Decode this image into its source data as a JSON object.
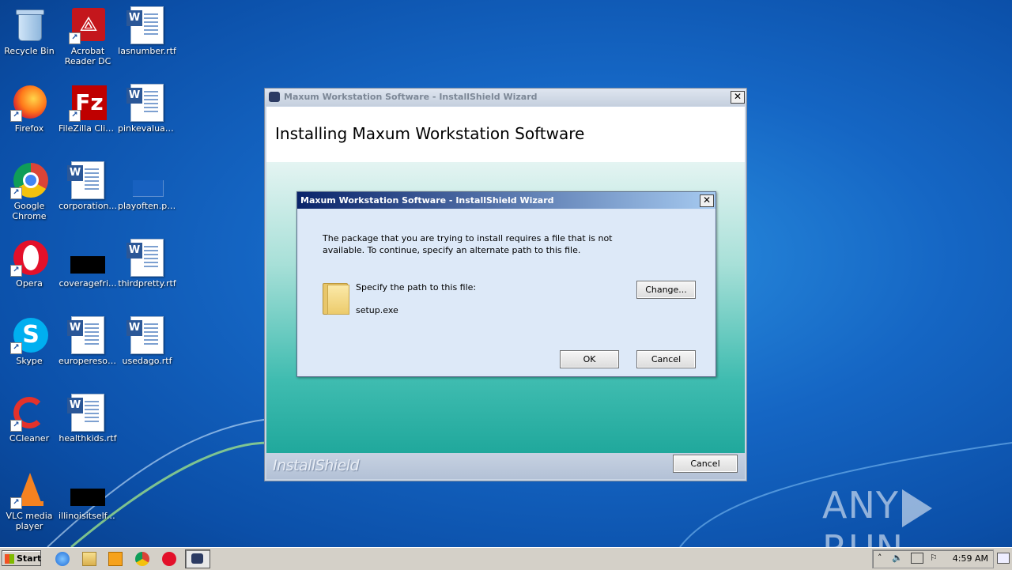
{
  "desktop_icons": [
    {
      "label": "Recycle Bin",
      "icon": "recycle-bin-icon"
    },
    {
      "label": "Acrobat Reader DC",
      "icon": "acrobat-icon"
    },
    {
      "label": "lasnumber.rtf",
      "icon": "word-doc-icon"
    },
    {
      "label": "Firefox",
      "icon": "firefox-icon"
    },
    {
      "label": "FileZilla Client",
      "icon": "filezilla-icon"
    },
    {
      "label": "pinkevaluati...",
      "icon": "word-doc-icon"
    },
    {
      "label": "Google Chrome",
      "icon": "chrome-icon"
    },
    {
      "label": "corporation...",
      "icon": "word-doc-icon"
    },
    {
      "label": "playoften.png",
      "icon": "image-icon"
    },
    {
      "label": "Opera",
      "icon": "opera-icon"
    },
    {
      "label": "coveragefri...",
      "icon": "image-black-icon"
    },
    {
      "label": "thirdpretty.rtf",
      "icon": "word-doc-icon"
    },
    {
      "label": "Skype",
      "icon": "skype-icon"
    },
    {
      "label": "europeresol...",
      "icon": "word-doc-icon"
    },
    {
      "label": "usedago.rtf",
      "icon": "word-doc-icon"
    },
    {
      "label": "CCleaner",
      "icon": "ccleaner-icon"
    },
    {
      "label": "healthkids.rtf",
      "icon": "word-doc-icon"
    },
    {
      "label": "VLC media player",
      "icon": "vlc-icon"
    },
    {
      "label": "illinoisitself.jpg",
      "icon": "image-black-icon"
    }
  ],
  "installer": {
    "title": "Maxum Workstation Software - InstallShield Wizard",
    "heading": "Installing Maxum Workstation Software",
    "brand": "InstallShield",
    "cancel_label": "Cancel"
  },
  "dialog": {
    "title": "Maxum Workstation Software - InstallShield Wizard",
    "message": "The package that you are trying to install requires a file that is not available. To continue, specify an alternate path to this file.",
    "path_label": "Specify the path to this file:",
    "file_name": "setup.exe",
    "change_label": "Change...",
    "ok_label": "OK",
    "cancel_label": "Cancel",
    "close_glyph": "✕"
  },
  "watermark": {
    "left": "ANY",
    "right": "RUN"
  },
  "taskbar": {
    "start_label": "Start",
    "clock": "4:59 AM"
  }
}
